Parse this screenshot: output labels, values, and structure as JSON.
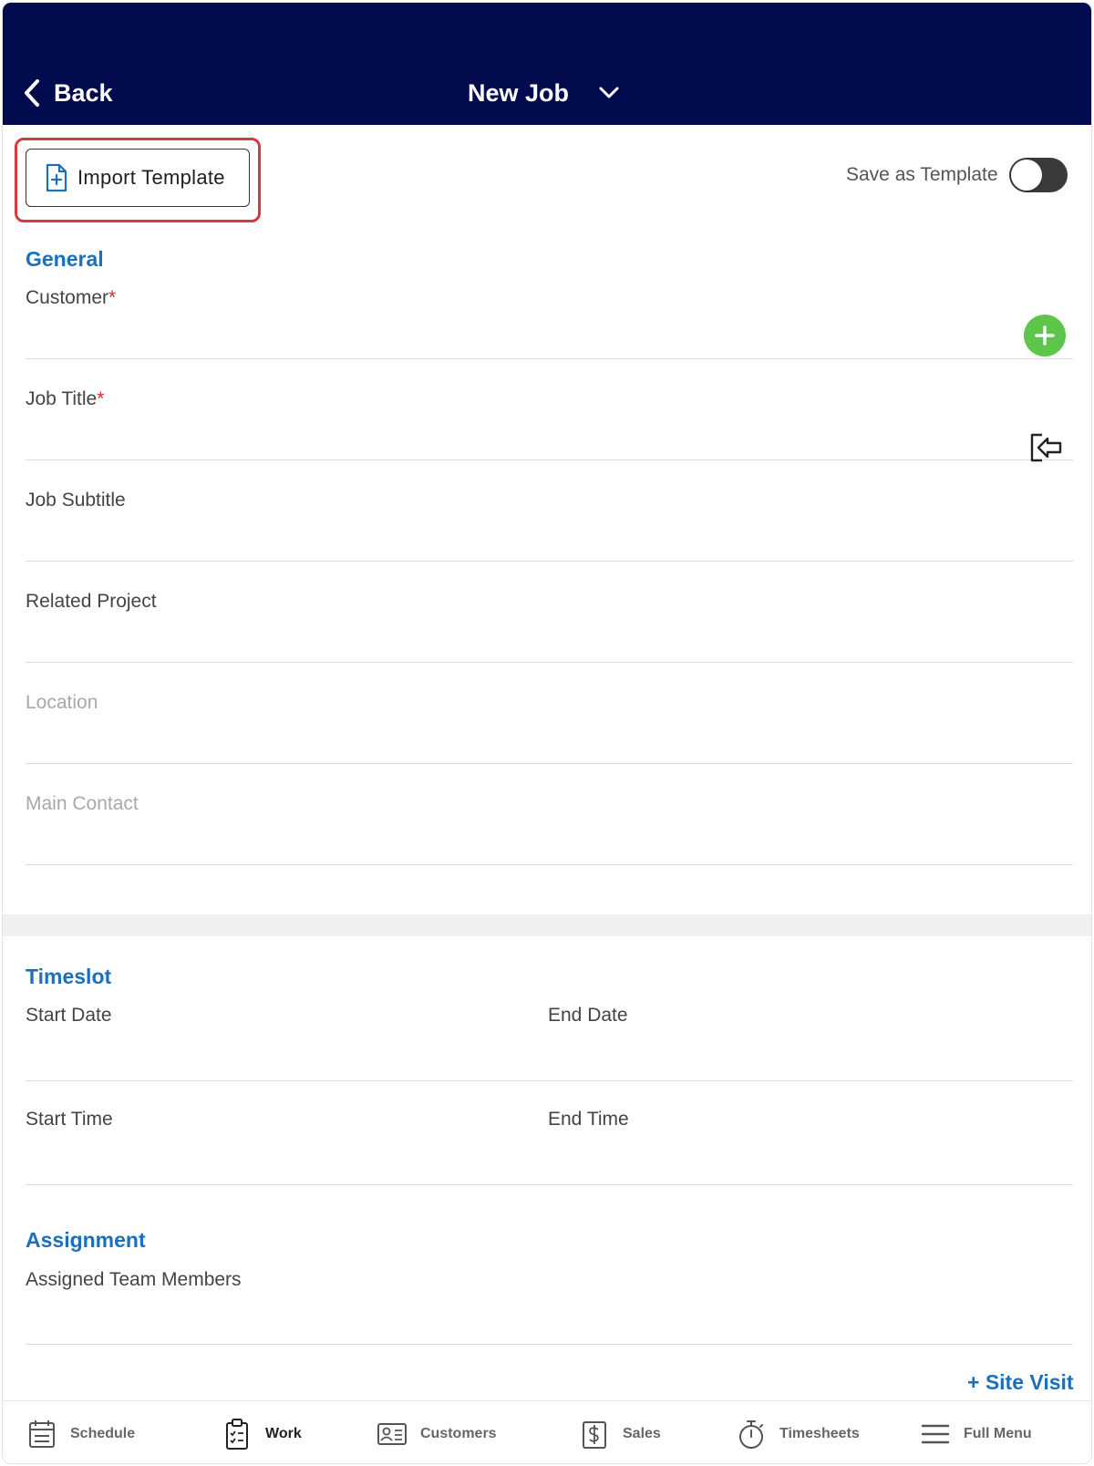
{
  "header": {
    "back_label": "Back",
    "title": "New Job",
    "background_color": "#030b4f"
  },
  "toolbar": {
    "import_template_label": "Import Template",
    "save_as_template_label": "Save as Template",
    "save_as_template_on": false
  },
  "general": {
    "section_title": "General",
    "customer_label": "Customer",
    "job_title_label": "Job Title",
    "required_marker": "*",
    "job_subtitle_label": "Job Subtitle",
    "related_project_label": "Related Project",
    "location_placeholder": "Location",
    "main_contact_placeholder": "Main Contact"
  },
  "timeslot": {
    "section_title": "Timeslot",
    "start_date_label": "Start Date",
    "end_date_label": "End Date",
    "start_time_label": "Start Time",
    "end_time_label": "End Time"
  },
  "assignment": {
    "section_title": "Assignment",
    "assigned_team_members_label": "Assigned Team Members"
  },
  "site_visit_label": "+ Site Visit",
  "bottom_nav": {
    "items": [
      {
        "label": "Schedule",
        "icon": "calendar-icon",
        "active": false
      },
      {
        "label": "Work",
        "icon": "clipboard-icon",
        "active": true
      },
      {
        "label": "Customers",
        "icon": "contact-card-icon",
        "active": false
      },
      {
        "label": "Sales",
        "icon": "dollar-icon",
        "active": false
      },
      {
        "label": "Timesheets",
        "icon": "stopwatch-icon",
        "active": false
      },
      {
        "label": "Full Menu",
        "icon": "menu-icon",
        "active": false
      }
    ]
  },
  "colors": {
    "accent_blue": "#1a6fbf",
    "add_green": "#5cc54a",
    "required_red": "#d12d2d",
    "highlight_red": "#d8393c"
  }
}
